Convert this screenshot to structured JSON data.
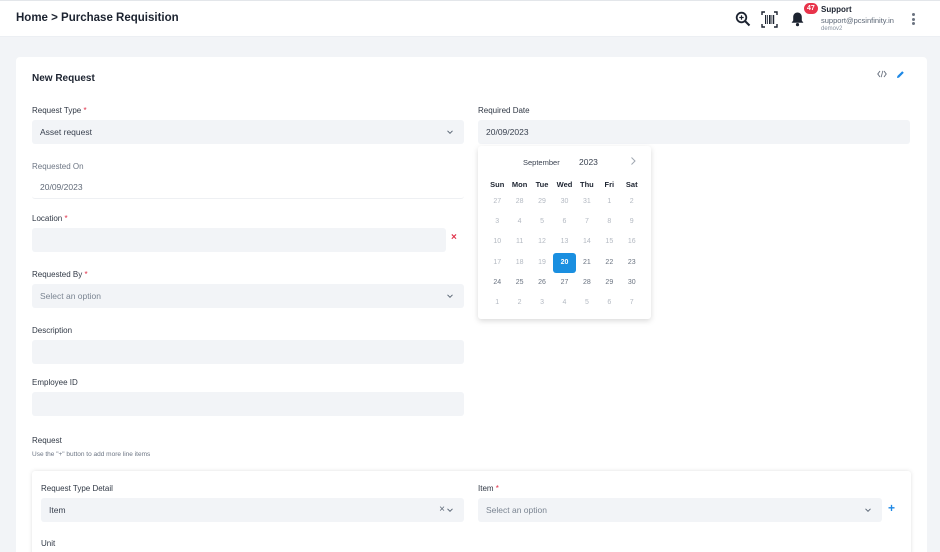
{
  "header": {
    "breadcrumb": "Home > Purchase Requisition",
    "notification_count": "47",
    "user": {
      "name": "Support",
      "email": "support@pcsinfinity.in",
      "org": "demov2"
    }
  },
  "card": {
    "title": "New Request",
    "request_type": {
      "label": "Request Type",
      "required": "*",
      "value": "Asset request"
    },
    "required_date": {
      "label": "Required Date",
      "value": "20/09/2023"
    },
    "requested_on": {
      "label": "Requested On",
      "value": "20/09/2023"
    },
    "location": {
      "label": "Location",
      "required": "*",
      "value": "",
      "clear": "×"
    },
    "requested_by": {
      "label": "Requested By",
      "required": "*",
      "placeholder": "Select an option"
    },
    "description": {
      "label": "Description",
      "value": ""
    },
    "employee_id": {
      "label": "Employee ID",
      "value": ""
    },
    "request_section": {
      "label": "Request",
      "hint": "Use the \"+\" button to add more line items"
    },
    "line_item": {
      "request_type_detail": {
        "label": "Request Type Detail",
        "value": "Item",
        "clear": "×"
      },
      "item": {
        "label": "Item",
        "required": "*",
        "placeholder": "Select an option",
        "add": "+"
      },
      "unit": {
        "label": "Unit"
      }
    }
  },
  "datepicker": {
    "month": "September",
    "year": "2023",
    "weekdays": [
      "Sun",
      "Mon",
      "Tue",
      "Wed",
      "Thu",
      "Fri",
      "Sat"
    ],
    "selected_day": "20",
    "days": [
      {
        "d": "27",
        "muted": true
      },
      {
        "d": "28",
        "muted": true
      },
      {
        "d": "29",
        "muted": true
      },
      {
        "d": "30",
        "muted": true
      },
      {
        "d": "31",
        "muted": true
      },
      {
        "d": "1",
        "muted": true
      },
      {
        "d": "2",
        "muted": true
      },
      {
        "d": "3",
        "muted": true
      },
      {
        "d": "4",
        "muted": true
      },
      {
        "d": "5",
        "muted": true
      },
      {
        "d": "6",
        "muted": true
      },
      {
        "d": "7",
        "muted": true
      },
      {
        "d": "8",
        "muted": true
      },
      {
        "d": "9",
        "muted": true
      },
      {
        "d": "10",
        "muted": true
      },
      {
        "d": "11",
        "muted": true
      },
      {
        "d": "12",
        "muted": true
      },
      {
        "d": "13",
        "muted": true
      },
      {
        "d": "14",
        "muted": true
      },
      {
        "d": "15",
        "muted": true
      },
      {
        "d": "16",
        "muted": true
      },
      {
        "d": "17",
        "muted": true
      },
      {
        "d": "18",
        "muted": true
      },
      {
        "d": "19",
        "muted": true
      },
      {
        "d": "20",
        "muted": false
      },
      {
        "d": "21",
        "muted": false
      },
      {
        "d": "22",
        "muted": false
      },
      {
        "d": "23",
        "muted": false
      },
      {
        "d": "24",
        "muted": false
      },
      {
        "d": "25",
        "muted": false
      },
      {
        "d": "26",
        "muted": false
      },
      {
        "d": "27",
        "muted": false
      },
      {
        "d": "28",
        "muted": false
      },
      {
        "d": "29",
        "muted": false
      },
      {
        "d": "30",
        "muted": false
      },
      {
        "d": "1",
        "muted": true
      },
      {
        "d": "2",
        "muted": true
      },
      {
        "d": "3",
        "muted": true
      },
      {
        "d": "4",
        "muted": true
      },
      {
        "d": "5",
        "muted": true
      },
      {
        "d": "6",
        "muted": true
      },
      {
        "d": "7",
        "muted": true
      }
    ]
  },
  "colors": {
    "accent": "#1a8fe0",
    "required": "#e0324a",
    "field_bg": "#f2f4f7"
  },
  "icons": [
    "search-zoom-icon",
    "barcode-icon",
    "bell-icon",
    "kebab-menu-icon",
    "code-icon",
    "edit-pencil-icon",
    "chevron-down-icon",
    "chevron-right-icon",
    "clear-icon",
    "add-icon"
  ]
}
